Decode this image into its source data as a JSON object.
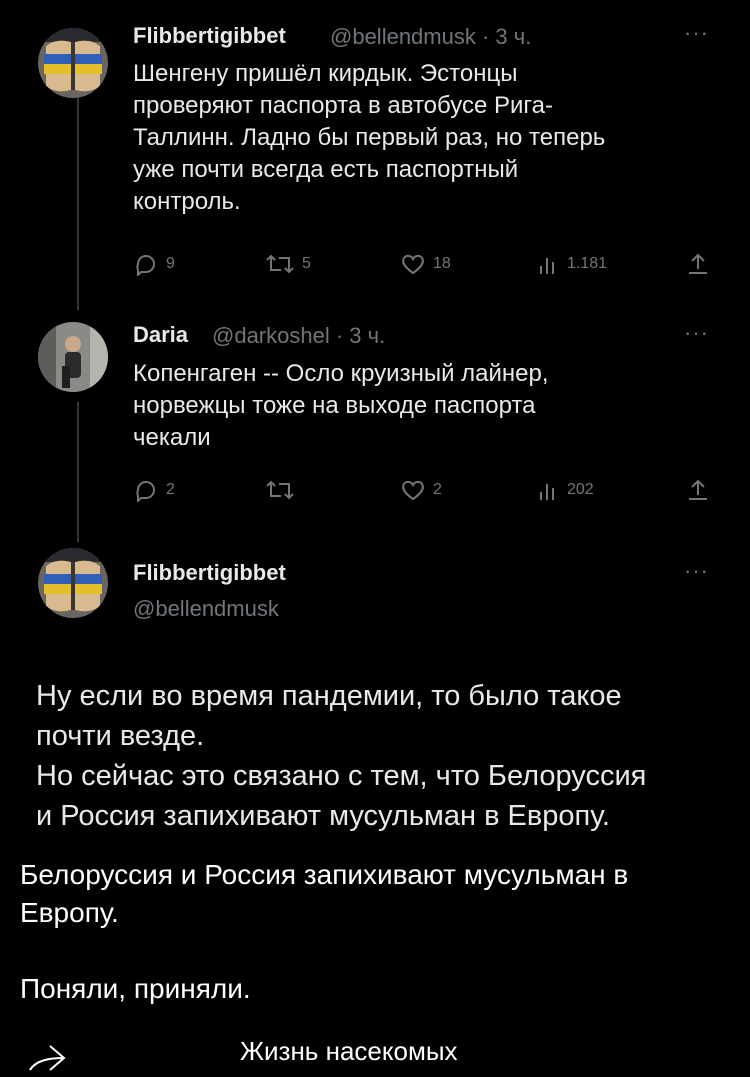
{
  "tweet1": {
    "name": "Flibbertigibbet",
    "handle_time": "@bellendmusk · 3 ч.",
    "lines": [
      "Шенгену пришёл кирдык. Эстонцы",
      "проверяют паспорта в автобусе Рига-",
      "Таллинн. Ладно бы первый раз, но теперь",
      "уже почти всегда есть паспортный",
      "контроль."
    ],
    "replies": "9",
    "retweets": "5",
    "likes": "18",
    "views": "1.181"
  },
  "tweet2": {
    "name": "Daria",
    "handle_time": "@darkoshel · 3 ч.",
    "lines": [
      "Копенгаген -- Осло круизный лайнер,",
      "норвежцы тоже на выходе паспорта",
      "чекали"
    ],
    "replies": "2",
    "retweets": "",
    "likes": "2",
    "views": "202"
  },
  "tweet3": {
    "name": "Flibbertigibbet",
    "handle": "@bellendmusk",
    "lines": [
      "Ну если во время пандемии, то было такое",
      "почти везде.",
      "Но сейчас это связано с тем, что Белоруссия",
      "и Россия запихивают мусульман в Европу."
    ]
  },
  "caption": {
    "line1": "Белоруссия и Россия запихивают мусульман в",
    "line2": "Европу.",
    "line3": "Поняли, приняли."
  },
  "footer": {
    "channel": "Жизнь насекомых"
  },
  "more_glyph": "···",
  "icons": [
    "reply-icon",
    "retweet-icon",
    "like-icon",
    "views-icon",
    "share-icon",
    "forward-icon"
  ]
}
